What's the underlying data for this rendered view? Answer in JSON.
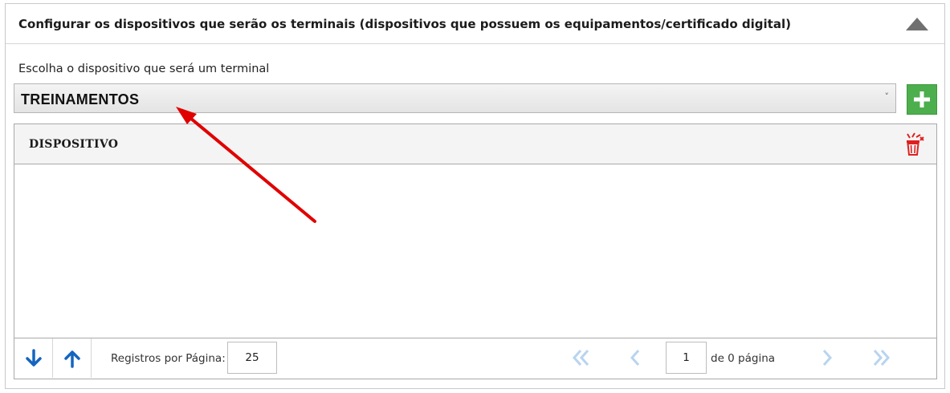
{
  "panel": {
    "title": "Configurar os dispositivos que serão os terminais (dispositivos que possuem os equipamentos/certificado digital)",
    "collapse_icon": "triangle-up-icon"
  },
  "device_select": {
    "label": "Escolha o dispositivo que será um terminal",
    "selected_value": "TREINAMENTOS",
    "chevron": "˅"
  },
  "add_button": {
    "icon": "plus-icon",
    "color": "#4cae4c"
  },
  "grid": {
    "columns": [
      "DISPOSITIVO"
    ],
    "delete_icon": "trash-icon",
    "delete_icon_color": "#e02020",
    "rows": []
  },
  "pager": {
    "records_label": "Registros por Página:",
    "records_per_page": "25",
    "current_page": "1",
    "page_of_label": "de 0 página",
    "sort_icons": [
      "arrow-down-icon",
      "arrow-up-icon"
    ],
    "accent_color": "#1565c0",
    "disabled_color": "#b8d4ef"
  },
  "annotation": {
    "arrow_color": "#e00000"
  }
}
